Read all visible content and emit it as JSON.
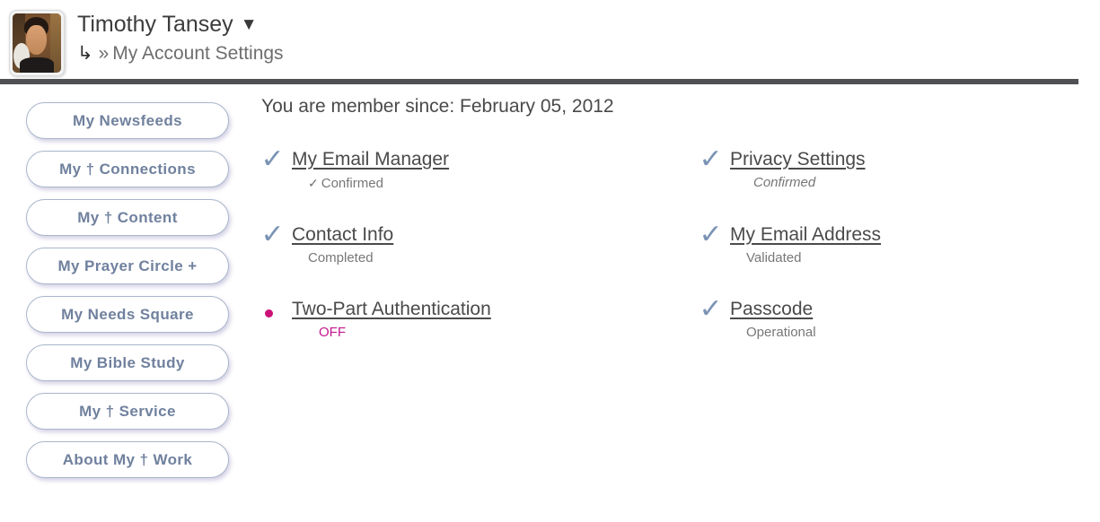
{
  "header": {
    "user_name": "Timothy Tansey",
    "caret_icon": "triangle-down-icon",
    "arrow_glyph": "↳",
    "chevron": "»",
    "breadcrumb_label": "My Account Settings",
    "avatar_alt": "user-avatar-photo"
  },
  "sidebar": {
    "items": [
      {
        "label": "My Newsfeeds",
        "name": "my-newsfeeds"
      },
      {
        "label": "My † Connections",
        "name": "my-connections"
      },
      {
        "label": "My † Content",
        "name": "my-content"
      },
      {
        "label": "My Prayer Circle +",
        "name": "my-prayer-circle"
      },
      {
        "label": "My Needs Square",
        "name": "my-needs-square"
      },
      {
        "label": "My Bible Study",
        "name": "my-bible-study"
      },
      {
        "label": "My † Service",
        "name": "my-service"
      },
      {
        "label": "About My † Work",
        "name": "about-my-work"
      }
    ]
  },
  "main": {
    "member_since": "You are member since: February 05, 2012",
    "items": [
      {
        "label": "My Email Manager",
        "status": "Confirmed",
        "status_prefix": "✓",
        "mark": "check",
        "style": "plain"
      },
      {
        "label": "Privacy Settings",
        "status": "Confirmed",
        "status_prefix": "",
        "mark": "check",
        "style": "italic"
      },
      {
        "label": "Contact Info",
        "status": "Completed",
        "status_prefix": "",
        "mark": "check",
        "style": "plain"
      },
      {
        "label": "My Email Address",
        "status": "Validated",
        "status_prefix": "",
        "mark": "check",
        "style": "plain"
      },
      {
        "label": "Two-Part Authentication",
        "status": "OFF",
        "status_prefix": "",
        "mark": "dot",
        "style": "off"
      },
      {
        "label": "Passcode",
        "status": "Operational",
        "status_prefix": "",
        "mark": "check",
        "style": "plain"
      }
    ]
  },
  "colors": {
    "check": "#7b94b5",
    "accent_magenta": "#c2198f",
    "bullet": "#cc1177",
    "nav_text": "#70819e",
    "nav_border": "#aab6cc",
    "rule": "#4e5053",
    "body_text": "#4a4a4a",
    "status_text": "#777777"
  },
  "glyphs": {
    "check_large": "✓",
    "check_small": "✓",
    "caret_down": "▼"
  }
}
